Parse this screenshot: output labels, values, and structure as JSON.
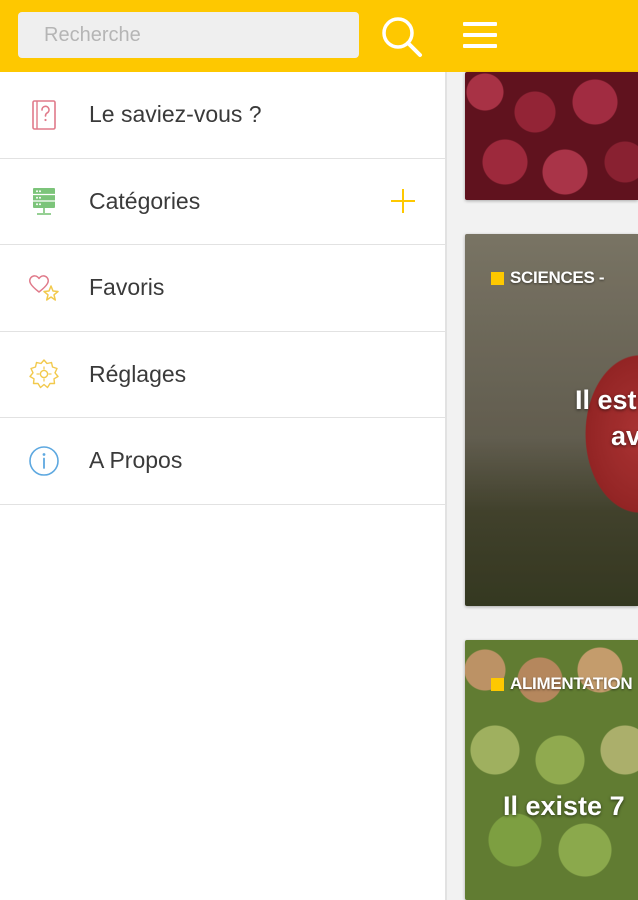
{
  "search": {
    "placeholder": "Recherche"
  },
  "drawer": {
    "items": [
      {
        "label": "Le saviez-vous ?",
        "icon": "question-book-icon"
      },
      {
        "label": "Catégories",
        "icon": "categories-icon",
        "expandable": true
      },
      {
        "label": "Favoris",
        "icon": "heart-star-icon"
      },
      {
        "label": "Réglages",
        "icon": "settings-gear-icon"
      },
      {
        "label": "A Propos",
        "icon": "info-icon"
      }
    ]
  },
  "feed": {
    "cards": [
      {
        "category": "",
        "title": ""
      },
      {
        "category": "SCIENCES -",
        "title": "Il est poss\navec"
      },
      {
        "category": "ALIMENTATION",
        "title": "Il existe 7"
      }
    ]
  },
  "colors": {
    "accent": "#fec800",
    "icon_pink": "#e07a8a",
    "icon_green": "#7cc47a",
    "icon_yellow": "#f2c94c",
    "icon_blue": "#5da8e0"
  }
}
